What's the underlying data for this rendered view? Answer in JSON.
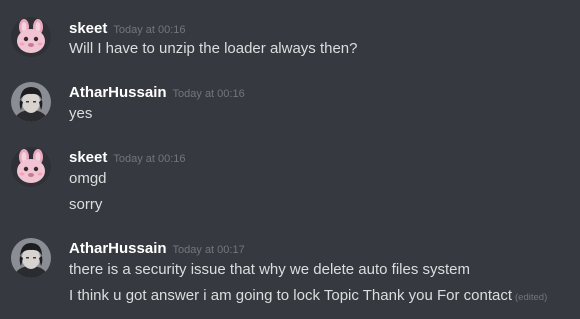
{
  "channel_messages": [
    {
      "author": "skeet",
      "timestamp": "Today at 00:16",
      "avatar_icon": "pink-bunny-avatar-icon",
      "lines": [
        {
          "text": "Will I have to unzip the loader always then?"
        }
      ]
    },
    {
      "author": "AtharHussain",
      "timestamp": "Today at 00:16",
      "avatar_icon": "dark-hair-person-avatar-icon",
      "lines": [
        {
          "text": "yes"
        }
      ]
    },
    {
      "author": "skeet",
      "timestamp": "Today at 00:16",
      "avatar_icon": "pink-bunny-avatar-icon",
      "lines": [
        {
          "text": "omgd"
        },
        {
          "text": "sorry"
        }
      ]
    },
    {
      "author": "AtharHussain",
      "timestamp": "Today at 00:17",
      "avatar_icon": "dark-hair-person-avatar-icon",
      "lines": [
        {
          "text": "there is a security issue that why we delete auto files system"
        },
        {
          "text": "I think u got answer i am going to lock Topic Thank you For contact",
          "edited": "(edited)"
        }
      ]
    }
  ],
  "colors": {
    "background": "#36393f",
    "username": "#ffffff",
    "message_text": "#dcddde",
    "timestamp": "#72767d"
  }
}
